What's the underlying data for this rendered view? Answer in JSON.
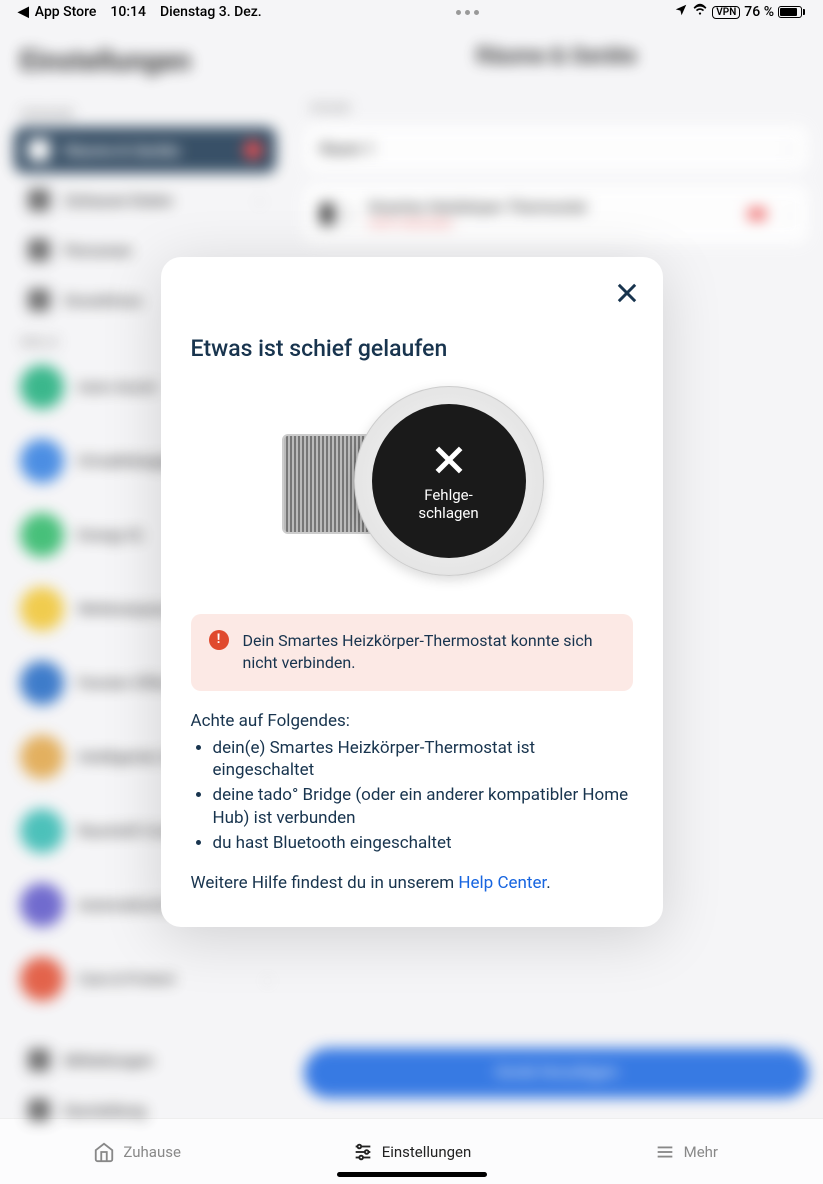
{
  "status_bar": {
    "back_app": "App Store",
    "time": "10:14",
    "date": "Dienstag 3. Dez.",
    "vpn": "VPN",
    "battery": "76 %"
  },
  "sidebar": {
    "title": "Einstellungen",
    "section1_label": "Zuhause",
    "items": [
      {
        "label": "Räume & Geräte"
      },
      {
        "label": "Zuhause-Daten"
      },
      {
        "label": "Personen"
      },
      {
        "label": "Grundrisss"
      }
    ],
    "section2_label": "Skills",
    "features": [
      {
        "label": "Auto-Assist"
      },
      {
        "label": "Ortsabhängige Steuerung"
      },
      {
        "label": "Energy IQ"
      },
      {
        "label": "Wetteranpassung"
      },
      {
        "label": "Fenster-Offen-Erkennung"
      },
      {
        "label": "Intelligenter Zeitplan"
      },
      {
        "label": "Raumluft-Comfort"
      },
      {
        "label": "Automatische Steuerung"
      },
      {
        "label": "Care & Protect"
      }
    ],
    "misc": [
      {
        "label": "Mitteilungen"
      },
      {
        "label": "Darstellung"
      }
    ]
  },
  "content": {
    "title": "Räume & Geräte",
    "section_label": "Räume",
    "room_name": "Raum 1",
    "device_name": "Smartes Heizkörper-Thermostat",
    "device_sub": "nicht verbunden",
    "add_button": "Gerät hinzufügen"
  },
  "tabbar": {
    "home": "Zuhause",
    "settings": "Einstellungen",
    "more": "Mehr"
  },
  "modal": {
    "title": "Etwas ist schief gelaufen",
    "device_status": "Fehlge-\nschlagen",
    "alert_text": "Dein Smartes Heizkörper-Thermostat konnte sich nicht verbinden.",
    "hint_title": "Achte auf Folgendes:",
    "hints": [
      "dein(e) Smartes Heizkörper-Thermostat ist eingeschaltet",
      "deine tado° Bridge (oder ein anderer kompatibler Home Hub) ist verbunden",
      "du hast Bluetooth eingeschaltet"
    ],
    "help_prefix": "Weitere Hilfe findest du in unserem ",
    "help_link": "Help Center",
    "help_suffix": "."
  }
}
